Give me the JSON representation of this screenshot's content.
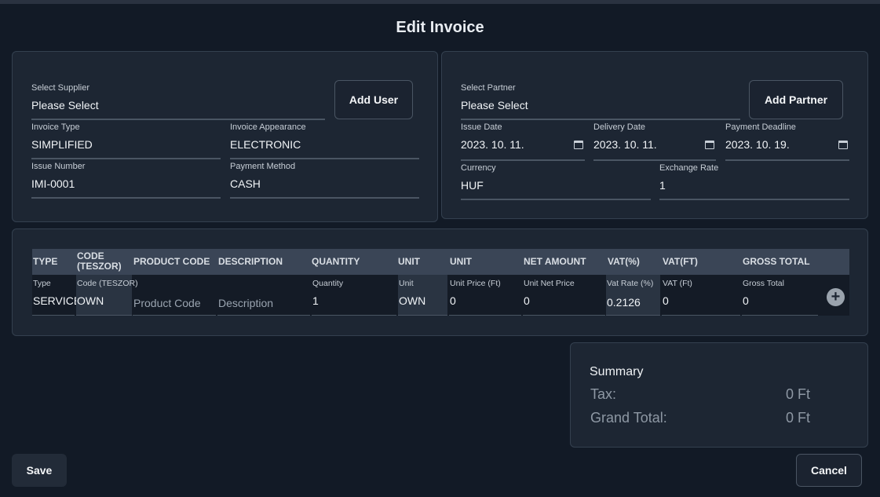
{
  "title": "Edit Invoice",
  "supplier": {
    "label": "Select Supplier",
    "value": "Please Select",
    "add_button": "Add User",
    "invoice_type_label": "Invoice Type",
    "invoice_type_value": "SIMPLIFIED",
    "invoice_appearance_label": "Invoice Appearance",
    "invoice_appearance_value": "ELECTRONIC",
    "issue_number_label": "Issue Number",
    "issue_number_value": "IMI-0001",
    "payment_method_label": "Payment Method",
    "payment_method_value": "CASH"
  },
  "partner": {
    "label": "Select Partner",
    "value": "Please Select",
    "add_button": "Add Partner",
    "issue_date_label": "Issue Date",
    "issue_date_value": "2023. 10. 11.",
    "delivery_date_label": "Delivery Date",
    "delivery_date_value": "2023. 10. 11.",
    "payment_deadline_label": "Payment Deadline",
    "payment_deadline_value": "2023. 10. 19.",
    "currency_label": "Currency",
    "currency_value": "HUF",
    "exchange_rate_label": "Exchange Rate",
    "exchange_rate_value": "1"
  },
  "table": {
    "headers": {
      "type": "TYPE",
      "code_1": "CODE",
      "code_2": "(TESZOR)",
      "product_code": "PRODUCT CODE",
      "description": "DESCRIPTION",
      "quantity": "QUANTITY",
      "unit": "UNIT",
      "unit_price": "UNIT",
      "net_amount": "NET AMOUNT",
      "vat_percent": "VAT(%)",
      "vat_ft": "VAT(FT)",
      "gross_total": "GROSS TOTAL"
    },
    "row": {
      "type_label": "Type",
      "type_value": "SERVICE",
      "code_label": "Code (TESZOR)",
      "code_value": "OWN",
      "product_code_placeholder": "Product Code",
      "description_placeholder": "Description",
      "quantity_label": "Quantity",
      "quantity_value": "1",
      "unit_label": "Unit",
      "unit_value": "OWN",
      "unit_price_label": "Unit Price (Ft)",
      "unit_price_value": "0",
      "unit_net_price_label": "Unit Net Price",
      "unit_net_price_value": "0",
      "vat_rate_label": "Vat Rate (%)",
      "vat_rate_value": "0.2126",
      "vat_ft_label": "VAT (Ft)",
      "vat_ft_value": "0",
      "gross_total_label": "Gross Total",
      "gross_total_value": "0",
      "add_icon": "+"
    }
  },
  "summary": {
    "title": "Summary",
    "tax_label": "Tax:",
    "tax_value": "0 Ft",
    "grand_total_label": "Grand Total:",
    "grand_total_value": "0 Ft"
  },
  "actions": {
    "save": "Save",
    "cancel": "Cancel"
  },
  "colors": {
    "background": "#121a26",
    "card": "#1d2633",
    "table_header": "#3a4556"
  }
}
